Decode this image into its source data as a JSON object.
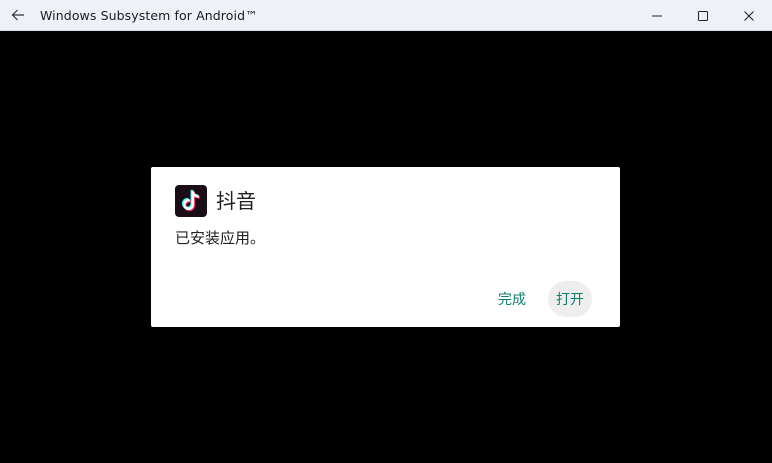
{
  "window": {
    "title": "Windows Subsystem for Android™",
    "back_icon": "back-arrow-icon",
    "controls": [
      "minimize-icon",
      "maximize-icon",
      "close-icon"
    ]
  },
  "dialog": {
    "app_name": "抖音",
    "app_icon": "tiktok-icon",
    "message": "已安装应用。",
    "buttons": {
      "done_label": "完成",
      "open_label": "打开"
    },
    "accent_color": "#0f7f6e"
  }
}
